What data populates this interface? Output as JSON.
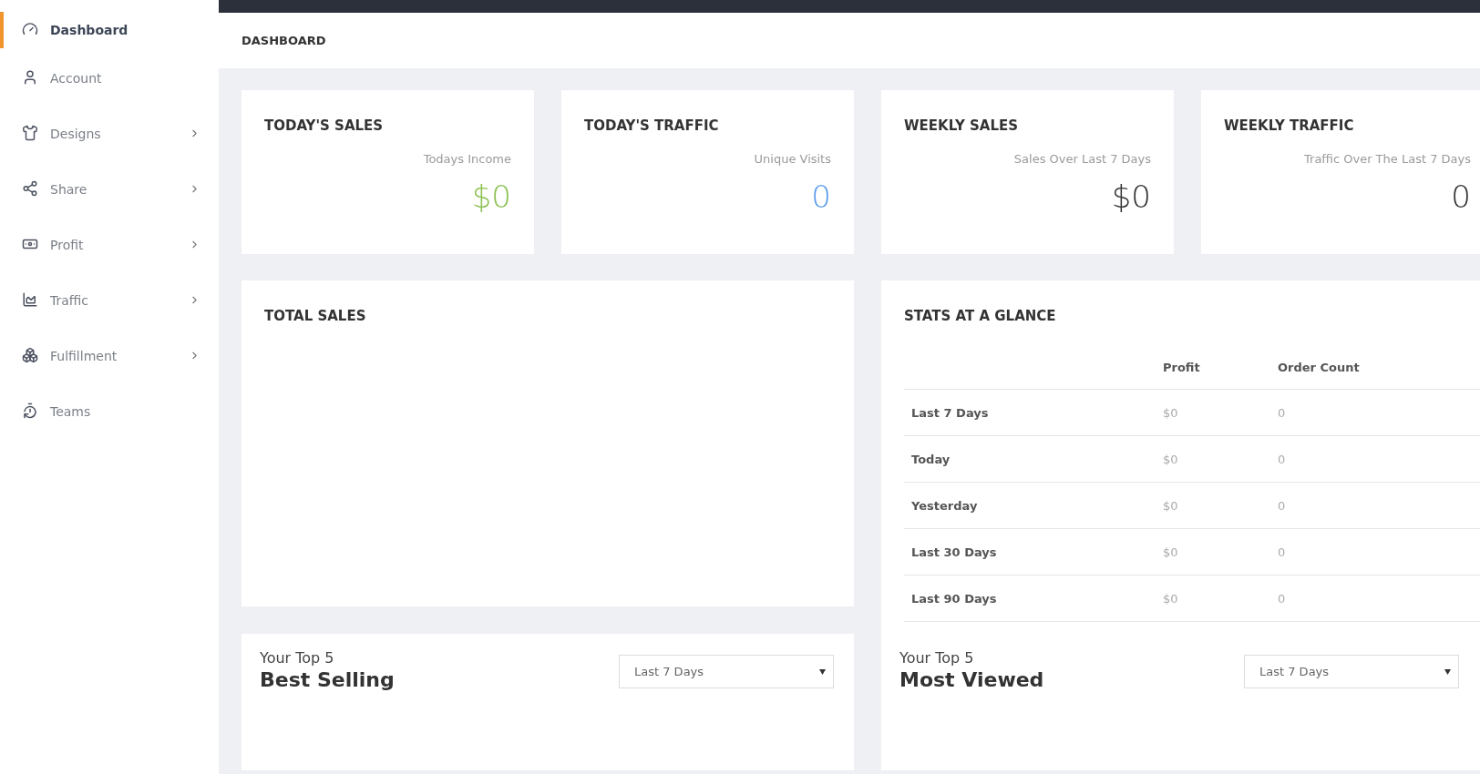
{
  "sidebar": {
    "items": [
      {
        "label": "Dashboard",
        "selected": true,
        "has_submenu": false
      },
      {
        "label": "Account",
        "selected": false,
        "has_submenu": false
      },
      {
        "label": "Designs",
        "selected": false,
        "has_submenu": true
      },
      {
        "label": "Share",
        "selected": false,
        "has_submenu": true
      },
      {
        "label": "Profit",
        "selected": false,
        "has_submenu": true
      },
      {
        "label": "Traffic",
        "selected": false,
        "has_submenu": true
      },
      {
        "label": "Fulfillment",
        "selected": false,
        "has_submenu": true
      },
      {
        "label": "Teams",
        "selected": false,
        "has_submenu": false
      }
    ]
  },
  "header": {
    "title": "DASHBOARD"
  },
  "stat_cards": [
    {
      "title": "TODAY'S SALES",
      "subtitle": "Todays Income",
      "value": "$0",
      "color": "#8cc152"
    },
    {
      "title": "TODAY'S TRAFFIC",
      "subtitle": "Unique Visits",
      "value": "0",
      "color": "#5d9cec"
    },
    {
      "title": "WEEKLY SALES",
      "subtitle": "Sales Over Last 7 Days",
      "value": "$0",
      "color": "#333333"
    },
    {
      "title": "WEEKLY TRAFFIC",
      "subtitle": "Traffic Over The Last 7 Days",
      "value": "0",
      "color": "#333333"
    }
  ],
  "total_sales": {
    "title": "TOTAL SALES"
  },
  "stats_at_a_glance": {
    "title": "STATS AT A GLANCE",
    "columns": [
      "Profit",
      "Order Count"
    ],
    "rows": [
      {
        "period": "Last 7 Days",
        "profit": "$0",
        "order_count": "0"
      },
      {
        "period": "Today",
        "profit": "$0",
        "order_count": "0"
      },
      {
        "period": "Yesterday",
        "profit": "$0",
        "order_count": "0"
      },
      {
        "period": "Last 30 Days",
        "profit": "$0",
        "order_count": "0"
      },
      {
        "period": "Last 90 Days",
        "profit": "$0",
        "order_count": "0"
      }
    ]
  },
  "top_panels": [
    {
      "overline": "Your Top 5",
      "title": "Best Selling",
      "dropdown": {
        "value": "Last 7 Days"
      }
    },
    {
      "overline": "Your Top 5",
      "title": "Most Viewed",
      "dropdown": {
        "value": "Last 7 Days"
      }
    }
  ]
}
